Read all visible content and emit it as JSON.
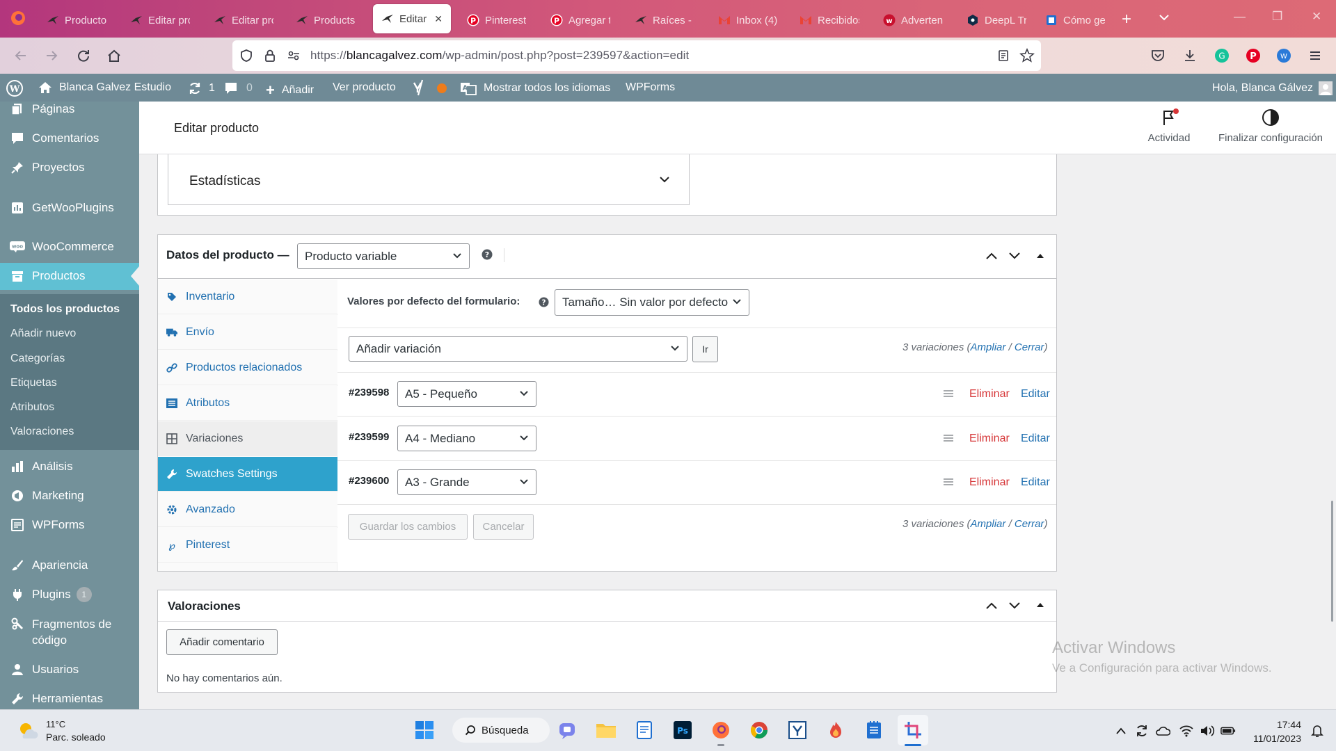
{
  "browser": {
    "tabs": [
      {
        "label": "Productos",
        "icon": "bird-icon"
      },
      {
        "label": "Editar pro",
        "icon": "bird-icon"
      },
      {
        "label": "Editar pro",
        "icon": "bird-icon"
      },
      {
        "label": "Products",
        "icon": "bird-icon"
      },
      {
        "label": "Editar p",
        "icon": "bird-icon",
        "active": true
      },
      {
        "label": "Pinterest",
        "icon": "pinterest-icon"
      },
      {
        "label": "Agregar t",
        "icon": "pinterest-icon"
      },
      {
        "label": "Raíces - B",
        "icon": "bird-icon"
      },
      {
        "label": "Inbox (4)",
        "icon": "gmail-icon"
      },
      {
        "label": "Recibidos",
        "icon": "gmail-icon"
      },
      {
        "label": "Advertenc",
        "icon": "w-icon"
      },
      {
        "label": "DeepL Tra",
        "icon": "deepl-icon"
      },
      {
        "label": "Cómo ge",
        "icon": "doc-icon"
      }
    ],
    "url_prefix": "https://",
    "url_domain": "blancagalvez.com",
    "url_path": "/wp-admin/post.php?post=239597&action=edit"
  },
  "adminbar": {
    "site_name": "Blanca Galvez Estudio",
    "updates_count": "1",
    "comments_count": "0",
    "add_label": "Añadir",
    "view_product": "Ver producto",
    "languages": "Mostrar todos los idiomas",
    "wpforms": "WPForms",
    "greeting": "Hola, Blanca Gálvez"
  },
  "sidebar": {
    "items": [
      {
        "label": "Páginas"
      },
      {
        "label": "Comentarios"
      },
      {
        "label": "Proyectos"
      },
      {
        "label": "GetWooPlugins"
      },
      {
        "label": "WooCommerce"
      },
      {
        "label": "Productos"
      },
      {
        "label": "Análisis"
      },
      {
        "label": "Marketing"
      },
      {
        "label": "WPForms"
      },
      {
        "label": "Apariencia"
      },
      {
        "label": "Plugins"
      },
      {
        "label": "Fragmentos de"
      },
      {
        "label": "Usuarios"
      },
      {
        "label": "Herramientas"
      }
    ],
    "fragmentos_line2": "código",
    "plugins_badge": "1",
    "submenu": [
      "Todos los productos",
      "Añadir nuevo",
      "Categorías",
      "Etiquetas",
      "Atributos",
      "Valoraciones"
    ]
  },
  "header": {
    "title": "Editar producto",
    "activity": "Actividad",
    "finish_setup": "Finalizar configuración"
  },
  "stats_panel": {
    "label": "Estadísticas"
  },
  "product_data": {
    "title": "Datos del producto —",
    "type_selected": "Producto variable",
    "tabs": [
      "Inventario",
      "Envío",
      "Productos relacionados",
      "Atributos",
      "Variaciones",
      "Swatches Settings",
      "Avanzado",
      "Pinterest"
    ],
    "defaults_label": "Valores por defecto del formulario:",
    "defaults_value": "Tamaño… Sin valor por defecto",
    "add_variation": "Añadir variación",
    "go_button": "Ir",
    "count_text": "3 variaciones (",
    "expand": "Ampliar",
    "sep": " / ",
    "close": "Cerrar",
    "close_paren": ")",
    "variations": [
      {
        "id": "#239598",
        "value": "A5 - Pequeño"
      },
      {
        "id": "#239599",
        "value": "A4 - Mediano"
      },
      {
        "id": "#239600",
        "value": "A3 - Grande"
      }
    ],
    "delete_label": "Eliminar",
    "edit_label": "Editar",
    "save_button": "Guardar los cambios",
    "cancel_button": "Cancelar"
  },
  "reviews": {
    "title": "Valoraciones",
    "add_comment": "Añadir comentario",
    "empty": "No hay comentarios aún."
  },
  "watermark": {
    "line1": "Activar Windows",
    "line2": "Ve a Configuración para activar Windows."
  },
  "taskbar": {
    "weather_temp": "11°C",
    "weather_desc": "Parc. soleado",
    "search": "Búsqueda",
    "time": "17:44",
    "date": "11/01/2023"
  }
}
